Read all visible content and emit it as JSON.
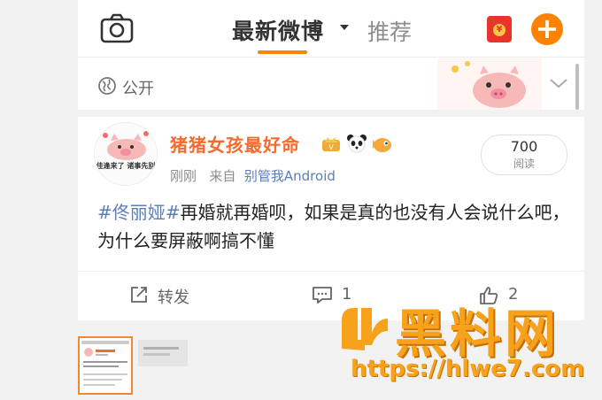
{
  "nav": {
    "camera_icon": "camera-icon",
    "tab_latest": "最新微博",
    "tab_recommend": "推荐",
    "redpacket_icon": "red-packet-icon",
    "compose_icon": "plus-icon",
    "accent": "#ff8200"
  },
  "visibility": {
    "icon": "globe-icon",
    "label": "公开",
    "chevron_icon": "chevron-down-icon"
  },
  "post": {
    "avatar_text": "佳逢来了 诸事先别",
    "username": "猪猪女孩最好命",
    "badges": [
      "vip-crown-icon",
      "panda-icon",
      "fish-icon"
    ],
    "time": "刚刚",
    "from_prefix": "来自",
    "source": "别管我Android",
    "read_count": "700",
    "read_label": "阅读",
    "hashtag": "#佟丽娅#",
    "text": "再婚就再婚呗，如果是真的也没有人会说什么吧，为什么要屏蔽啊搞不懂",
    "actions": {
      "repost_label": "转发",
      "comment_count": "1",
      "like_count": "2"
    }
  },
  "watermark": {
    "title": "黑料网",
    "url": "https://hlwe7.com"
  }
}
